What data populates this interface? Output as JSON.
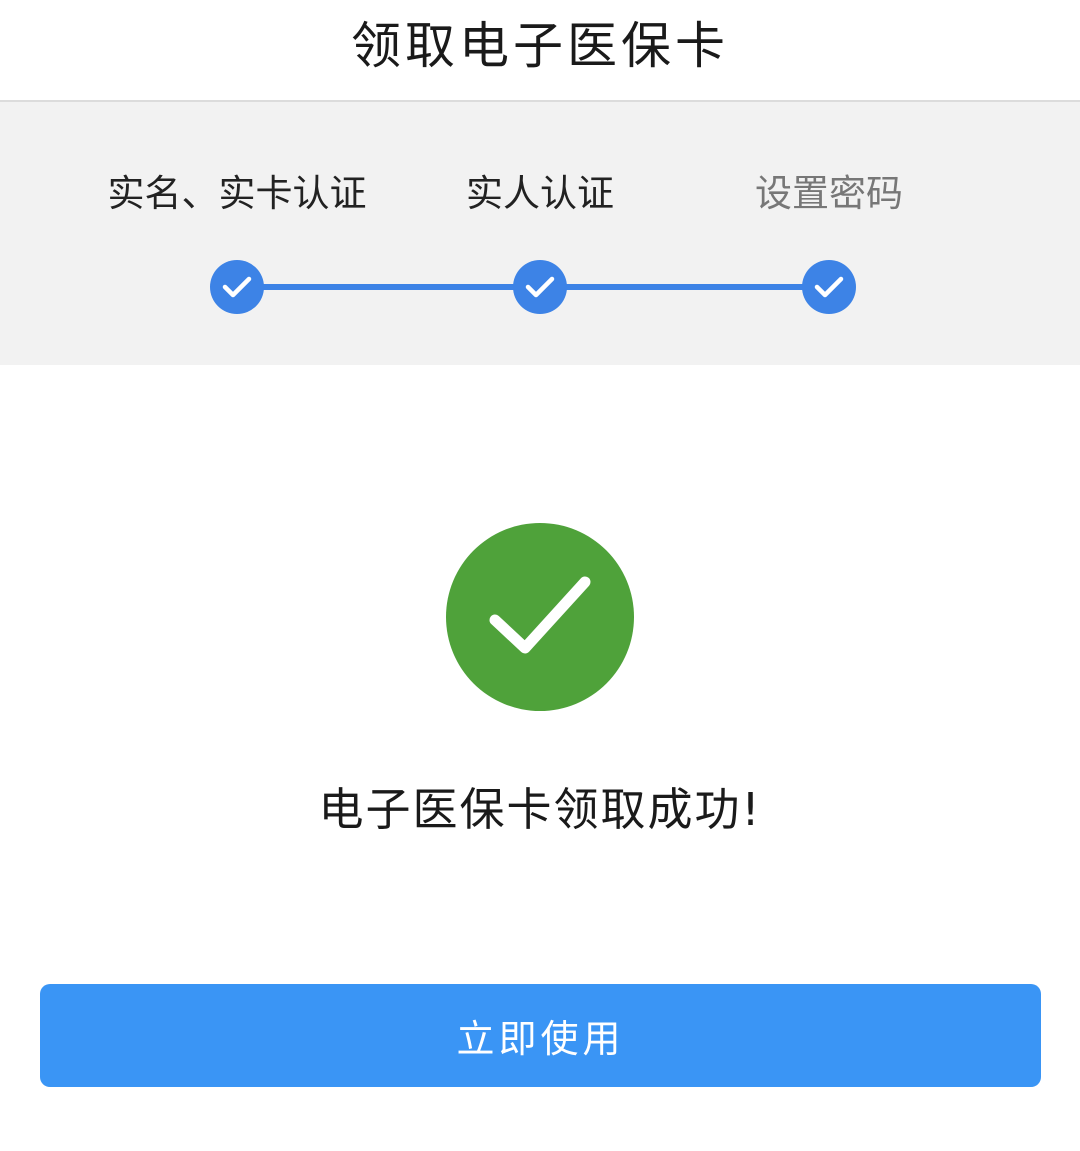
{
  "header": {
    "title": "领取电子医保卡"
  },
  "steps": {
    "items": [
      {
        "label": "实名、实卡认证",
        "status": "completed"
      },
      {
        "label": "实人认证",
        "status": "completed"
      },
      {
        "label": "设置密码",
        "status": "completed"
      }
    ],
    "active_color": "#3d83e6"
  },
  "result": {
    "icon": "check-circle-icon",
    "color": "#4fa23a",
    "message": "电子医保卡领取成功!"
  },
  "actions": {
    "use_now_label": "立即使用",
    "color": "#3a95f5"
  }
}
